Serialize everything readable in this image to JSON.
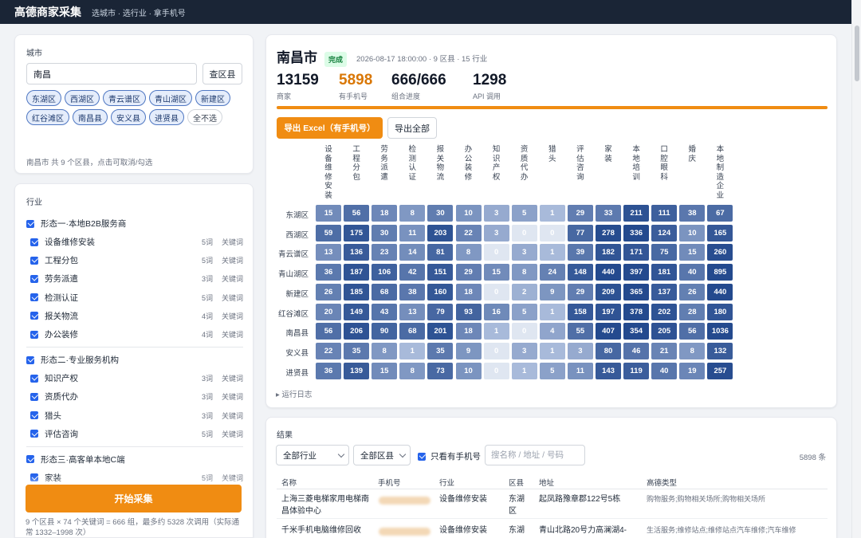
{
  "app": {
    "title": "高德商家采集",
    "tagline": "选城市 · 选行业 · 拿手机号"
  },
  "city_panel": {
    "label": "城市",
    "input_value": "南昌",
    "lookup_button": "查区县",
    "districts": [
      {
        "name": "东湖区",
        "selected": true
      },
      {
        "name": "西湖区",
        "selected": true
      },
      {
        "name": "青云谱区",
        "selected": true
      },
      {
        "name": "青山湖区",
        "selected": true
      },
      {
        "name": "新建区",
        "selected": true
      },
      {
        "name": "红谷滩区",
        "selected": true
      },
      {
        "name": "南昌县",
        "selected": true
      },
      {
        "name": "安义县",
        "selected": true
      },
      {
        "name": "进贤县",
        "selected": true
      }
    ],
    "clear_all": "全不选",
    "hint": "南昌市 共 9 个区县，点击可取消/勾选"
  },
  "industry_panel": {
    "label": "行业",
    "groups": [
      {
        "title": "形态一·本地B2B服务商",
        "items": [
          {
            "name": "设备维修安装",
            "count": "5词",
            "kw": "关键词"
          },
          {
            "name": "工程分包",
            "count": "5词",
            "kw": "关键词"
          },
          {
            "name": "劳务派遣",
            "count": "3词",
            "kw": "关键词"
          },
          {
            "name": "检测认证",
            "count": "5词",
            "kw": "关键词"
          },
          {
            "name": "报关物流",
            "count": "4词",
            "kw": "关键词"
          },
          {
            "name": "办公装修",
            "count": "4词",
            "kw": "关键词"
          }
        ]
      },
      {
        "title": "形态二·专业服务机构",
        "items": [
          {
            "name": "知识产权",
            "count": "3词",
            "kw": "关键词"
          },
          {
            "name": "资质代办",
            "count": "3词",
            "kw": "关键词"
          },
          {
            "name": "猎头",
            "count": "3词",
            "kw": "关键词"
          },
          {
            "name": "评估咨询",
            "count": "5词",
            "kw": "关键词"
          }
        ]
      },
      {
        "title": "形态三·高客单本地C端",
        "items": [
          {
            "name": "家装",
            "count": "5词",
            "kw": "关键词"
          }
        ]
      }
    ]
  },
  "start_button": "开始采集",
  "estimate": "9 个区县 × 74 个关键词 = 666 组，最多约 5328 次调用（实际通常 1332–1998 次）",
  "summary": {
    "city": "南昌市",
    "status": "完成",
    "meta": "2026-08-17 18:00:00 · 9 区县 · 15 行业",
    "stats": [
      {
        "value": "13159",
        "label": "商家"
      },
      {
        "value": "5898",
        "label": "有手机号"
      },
      {
        "value": "666/666",
        "label": "组合进度"
      },
      {
        "value": "1298",
        "label": "API 调用"
      }
    ],
    "progress": 1.0,
    "export_phone": "导出 Excel（有手机号）",
    "export_all": "导出全部",
    "log_toggle": "▸ 运行日志"
  },
  "chart_data": {
    "type": "heatmap",
    "columns": [
      "设备维修安装",
      "工程分包",
      "劳务派遣",
      "检测认证",
      "报关物流",
      "办公装修",
      "知识产权",
      "资质代办",
      "猎头",
      "评估咨询",
      "家装",
      "本地培训",
      "口腔眼科",
      "婚庆",
      "本地制造企业"
    ],
    "rows": [
      "东湖区",
      "西湖区",
      "青云谱区",
      "青山湖区",
      "新建区",
      "红谷滩区",
      "南昌县",
      "安义县",
      "进贤县"
    ],
    "values": [
      [
        15,
        56,
        18,
        8,
        30,
        10,
        3,
        5,
        1,
        29,
        33,
        211,
        111,
        38,
        67
      ],
      [
        59,
        175,
        30,
        11,
        203,
        22,
        3,
        0,
        0,
        77,
        278,
        336,
        124,
        10,
        165
      ],
      [
        13,
        136,
        23,
        14,
        81,
        8,
        0,
        3,
        1,
        39,
        182,
        171,
        75,
        15,
        260
      ],
      [
        36,
        187,
        106,
        42,
        151,
        29,
        15,
        8,
        24,
        148,
        440,
        397,
        181,
        40,
        895
      ],
      [
        26,
        185,
        68,
        38,
        160,
        18,
        0,
        2,
        9,
        29,
        209,
        365,
        137,
        26,
        440
      ],
      [
        20,
        149,
        43,
        13,
        79,
        93,
        16,
        5,
        1,
        158,
        197,
        378,
        202,
        28,
        180
      ],
      [
        56,
        206,
        90,
        68,
        201,
        18,
        1,
        0,
        4,
        55,
        407,
        354,
        205,
        56,
        1036
      ],
      [
        22,
        35,
        8,
        1,
        35,
        9,
        0,
        3,
        1,
        3,
        80,
        46,
        21,
        8,
        132
      ],
      [
        36,
        139,
        15,
        8,
        73,
        10,
        0,
        1,
        5,
        11,
        143,
        119,
        40,
        19,
        257
      ]
    ]
  },
  "results": {
    "label": "结果",
    "industry_filter": "全部行业",
    "district_filter": "全部区县",
    "phone_only": "只看有手机号",
    "search_placeholder": "搜名称 / 地址 / 号码",
    "count": "5898 条",
    "columns": [
      "名称",
      "手机号",
      "行业",
      "区县",
      "地址",
      "高德类型"
    ],
    "rows": [
      {
        "name": "上海三菱电梯家用电梯南昌体验中心",
        "industry": "设备维修安装",
        "district": "东湖区",
        "address": "起凤路豫章郡122号5栋",
        "type": "购物服务;购物相关场所;购物相关场所"
      },
      {
        "name": "千米手机电脑维修回收",
        "industry": "设备维修安装",
        "district": "东湖",
        "address": "青山北路20号力高澜湖4-",
        "type": "生活服务;维修站点;维修站点汽车维修;汽车维修"
      }
    ]
  }
}
